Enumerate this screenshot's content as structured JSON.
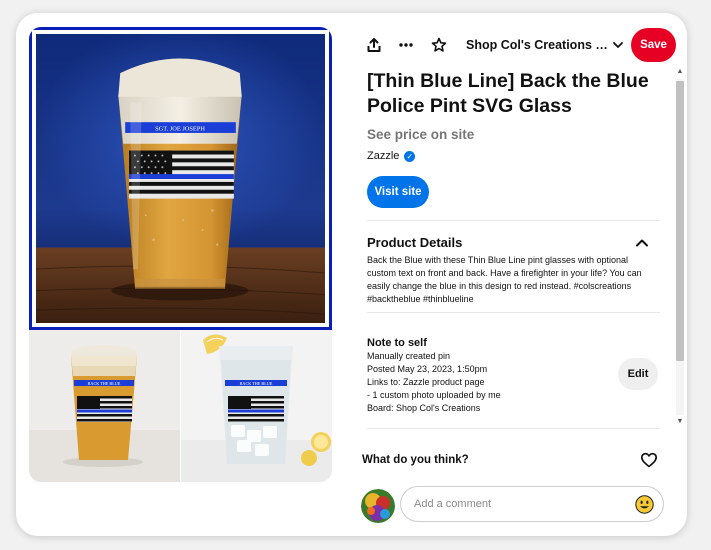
{
  "topbar": {
    "share_icon": "share-upload-icon",
    "more_icon": "ellipsis-icon",
    "star_icon": "star-outline-icon",
    "board_name": "Shop Col's Creations on...",
    "board_chevron_icon": "chevron-down-icon",
    "save_label": "Save"
  },
  "pin": {
    "title": "[Thin Blue Line] Back the Blue Police Pint SVG Glass",
    "price_text": "See price on site",
    "merchant": "Zazzle",
    "verified_icon": "verified-check-icon",
    "visit_label": "Visit site",
    "main_image": {
      "glass_text": "SGT. JOE JOSEPH"
    },
    "thumb1": {
      "glass_text": "BACK THE BLUE"
    },
    "thumb2": {
      "glass_text": "BACK THE BLUE"
    }
  },
  "details": {
    "heading": "Product Details",
    "chevron_icon": "chevron-up-icon",
    "description": "Back the Blue with these Thin Blue Line pint glasses with optional custom text on front and back. Have a firefighter in your life? You can easily change the blue in this design to red instead. #colscreations #backtheblue #thinblueline"
  },
  "note": {
    "heading": "Note to self",
    "lines": [
      "Manually created pin",
      "Posted May 23, 2023, 1:50pm",
      "Links to: Zazzle product page",
      "- 1 custom photo uploaded by me",
      "Board: Shop Col's Creations"
    ],
    "edit_label": "Edit"
  },
  "comments": {
    "prompt": "What do you think?",
    "heart_icon": "heart-outline-icon",
    "placeholder": "Add a comment",
    "emoji_icon": "smiley-emoji-icon"
  },
  "colors": {
    "save_red": "#e60023",
    "visit_blue": "#0074e8",
    "image_border": "#0a1fb8"
  }
}
